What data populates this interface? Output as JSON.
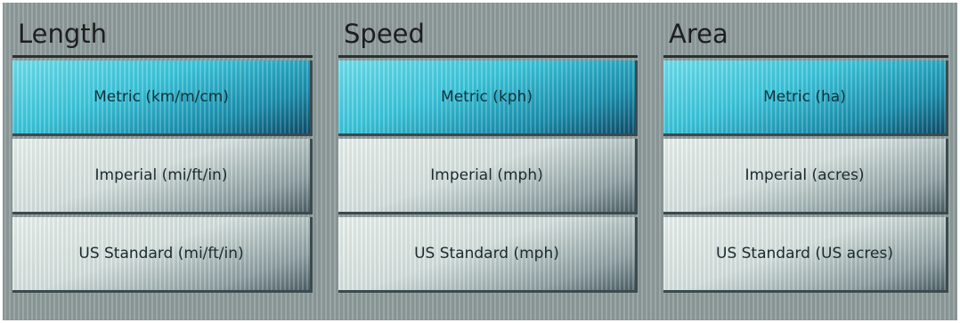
{
  "groups": [
    {
      "title": "Length",
      "options": [
        {
          "label": "Metric (km/m/cm)",
          "selected": true
        },
        {
          "label": "Imperial (mi/ft/in)",
          "selected": false
        },
        {
          "label": "US Standard (mi/ft/in)",
          "selected": false
        }
      ]
    },
    {
      "title": "Speed",
      "options": [
        {
          "label": "Metric (kph)",
          "selected": true
        },
        {
          "label": "Imperial (mph)",
          "selected": false
        },
        {
          "label": "US Standard (mph)",
          "selected": false
        }
      ]
    },
    {
      "title": "Area",
      "options": [
        {
          "label": "Metric (ha)",
          "selected": true
        },
        {
          "label": "Imperial (acres)",
          "selected": false
        },
        {
          "label": "US Standard (US acres)",
          "selected": false
        }
      ]
    }
  ],
  "colors": {
    "selected_accent": "#3cc6dc",
    "unselected_base": "#d5e1de",
    "divider": "#2f2f2f"
  }
}
